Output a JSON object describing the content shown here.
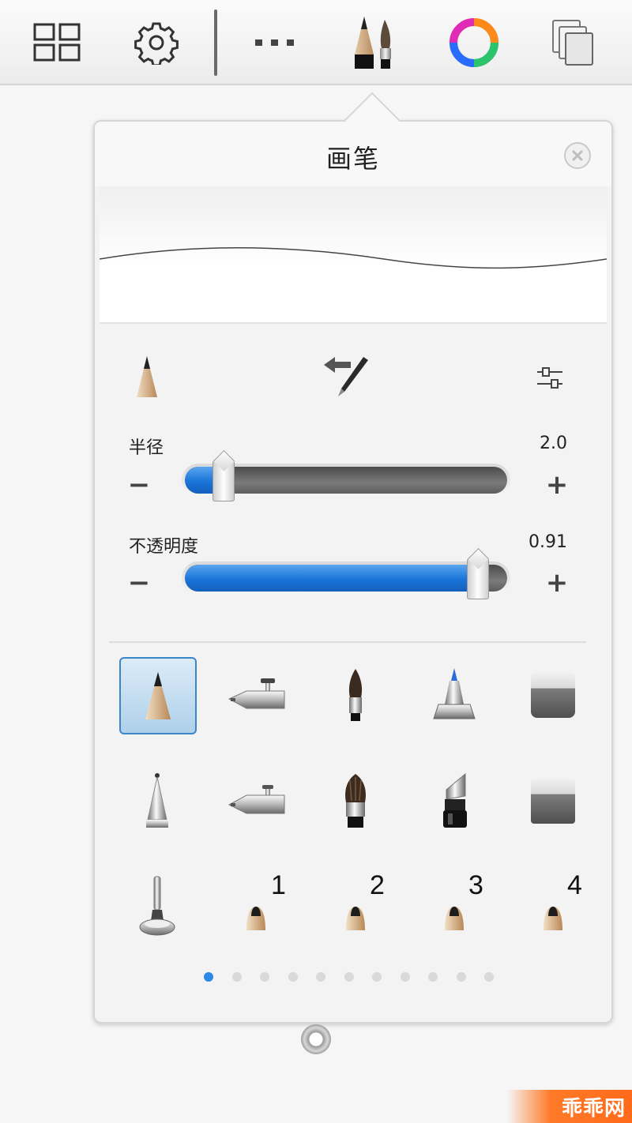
{
  "toolbar": {
    "icons": [
      "gallery-grid-icon",
      "settings-gear-icon",
      "more-options-icon",
      "brushes-icon",
      "color-wheel-icon",
      "layers-icon"
    ]
  },
  "brush_panel": {
    "title": "画笔",
    "radius": {
      "label": "半径",
      "value": "2.0",
      "fraction": 0.12
    },
    "opacity": {
      "label": "不透明度",
      "value": "0.91",
      "fraction": 0.91
    },
    "minus_label": "−",
    "plus_label": "+",
    "brushes": [
      "pencil-icon",
      "airbrush-icon",
      "paintbrush-icon",
      "marker-icon",
      "eraser-icon",
      "ballpoint-pen-icon",
      "airbrush-small-icon",
      "wide-brush-icon",
      "chisel-marker-icon",
      "wide-eraser-icon",
      "smudge-tool-icon"
    ],
    "custom_slots": [
      "1",
      "2",
      "3",
      "4"
    ],
    "page_dots": {
      "count": 11,
      "active": 0
    }
  },
  "watermark": {
    "text": "乖乖网"
  },
  "colors": {
    "accent": "#2c8ae6",
    "slider_fill": "#1a74d8",
    "track": "#5d5d5d"
  }
}
